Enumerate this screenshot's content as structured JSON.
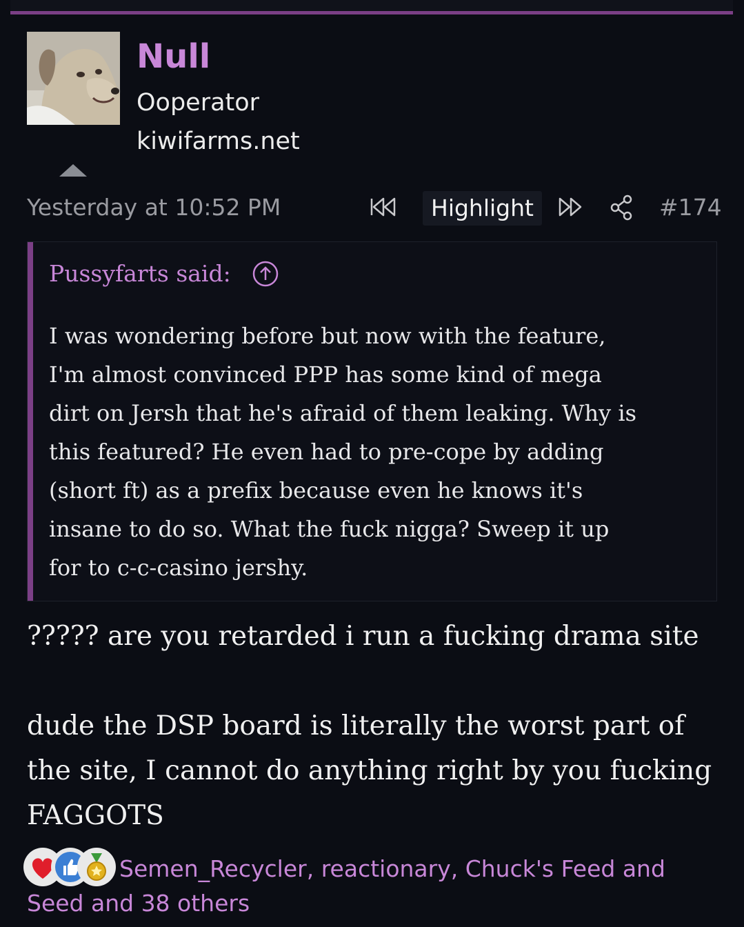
{
  "post": {
    "author": {
      "name": "Null",
      "title": "Ooperator",
      "banner": "kiwifarms.net",
      "avatar": "dog-avatar"
    },
    "timestamp": "Yesterday at 10:52 PM",
    "actions": {
      "prev_icon": "rewind-icon",
      "highlight_label": "Highlight",
      "next_icon": "fast-forward-icon",
      "share_icon": "share-icon"
    },
    "post_number": "#174",
    "quote": {
      "attribution": "Pussyfarts said:",
      "expand_icon": "arrow-up-circle-icon",
      "text": "I was wondering before but now with the feature,\nI'm almost convinced PPP has some kind of mega\ndirt on Jersh that he's afraid of them leaking. Why is\nthis featured? He even had to pre-cope by adding\n(short ft) as a prefix because even he knows it's\ninsane to do so. What the fuck nigga? Sweep it up\nfor to c-c-casino jershy."
    },
    "body": {
      "line1": "????? are you retarded i run a fucking drama site",
      "line2": "dude the DSP board is literally the worst part of the site, I cannot do anything right by you fucking FAGGOTS"
    },
    "reactions": {
      "icons": [
        "heart-icon",
        "thumbs-up-icon",
        "medal-icon"
      ],
      "users_text": "Semen_Recycler, reactionary, Chuck's Feed and Seed and 38 others"
    }
  },
  "colors": {
    "background": "#0b0d14",
    "accent": "#7b3f86",
    "link": "#c887d8",
    "muted": "#9a9ba1"
  }
}
